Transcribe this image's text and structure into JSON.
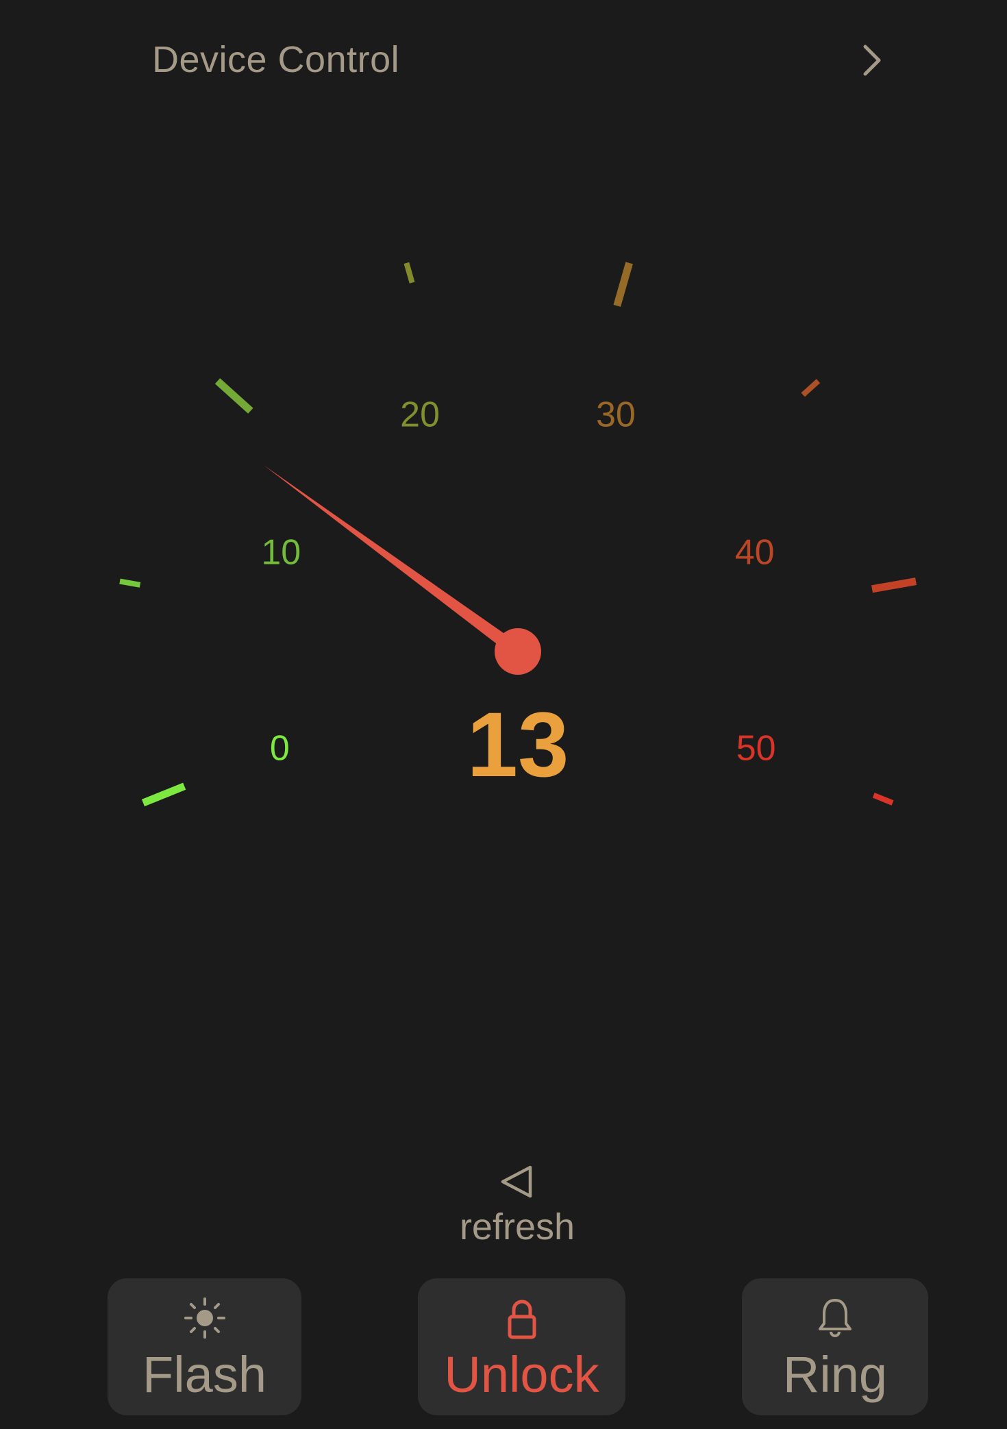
{
  "header": {
    "title": "Device Control",
    "chevron_icon": "chevron-right-icon"
  },
  "gauge": {
    "value": "13",
    "value_numeric": 13,
    "min": 0,
    "max": 50,
    "scale_labels": [
      "0",
      "10",
      "20",
      "30",
      "40",
      "50"
    ],
    "needle_color": "#e25444",
    "value_color": "#eaa03c"
  },
  "refresh": {
    "label": "refresh",
    "icon": "triangle-left-icon"
  },
  "actions": {
    "flash": {
      "label": "Flash",
      "icon": "sun-icon",
      "color": "#a59a88"
    },
    "unlock": {
      "label": "Unlock",
      "icon": "lock-icon",
      "color": "#e25444"
    },
    "ring": {
      "label": "Ring",
      "icon": "bell-icon",
      "color": "#a59a88"
    }
  },
  "colors": {
    "background": "#1b1b1b",
    "button_bg": "#2e2e2f",
    "muted_text": "#a59a88"
  }
}
